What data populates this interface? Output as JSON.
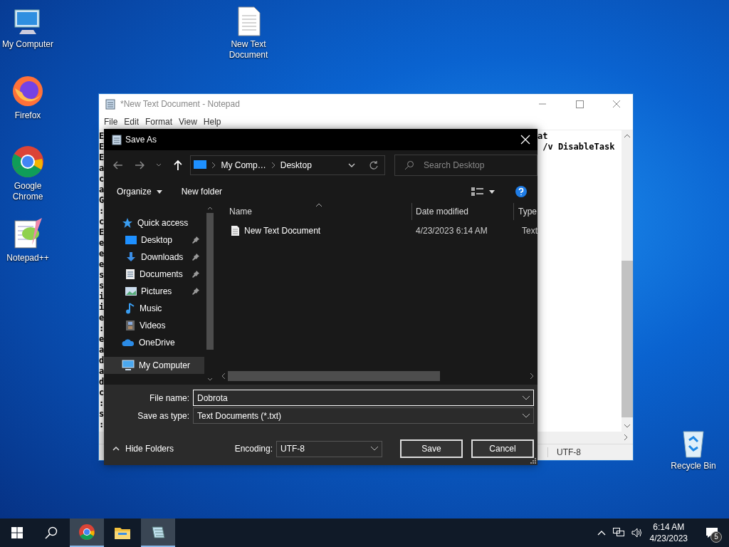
{
  "desktop_icons": [
    {
      "label": "My Computer",
      "kind": "computer"
    },
    {
      "label": "New Text Document",
      "kind": "document"
    },
    {
      "label": "Firefox",
      "kind": "firefox"
    },
    {
      "label": "Google Chrome",
      "kind": "chrome"
    },
    {
      "label": "Notepad++",
      "kind": "notepadpp"
    },
    {
      "label": "Recycle Bin",
      "kind": "recycle"
    }
  ],
  "notepad": {
    "title": "*New Text Document - Notepad",
    "menu": [
      "File",
      "Edit",
      "Format",
      "View",
      "Help"
    ],
    "lines": [
      {
        "start": "E",
        "end": "at"
      },
      {
        "start": "E",
        "end": " /v DisableTask"
      },
      {
        "start": "E"
      },
      {
        "start": "a"
      },
      {
        "start": "c"
      },
      {
        "start": "a"
      },
      {
        "start": "G"
      },
      {
        "start": ":"
      },
      {
        "start": "c"
      },
      {
        "start": "E"
      },
      {
        "start": "e"
      },
      {
        "start": "e"
      },
      {
        "start": "e"
      },
      {
        "start": "s"
      },
      {
        "start": "s"
      },
      {
        "start": "i"
      },
      {
        "start": "i"
      },
      {
        "start": "e"
      },
      {
        "start": ":"
      },
      {
        "start": "e"
      },
      {
        "start": "a"
      },
      {
        "start": "d"
      },
      {
        "start": "a"
      },
      {
        "start": "d"
      },
      {
        "start": "c"
      },
      {
        "start": ":"
      },
      {
        "start": "s"
      },
      {
        "start": ":"
      }
    ],
    "status": "UTF-8"
  },
  "dialog": {
    "title": "Save As",
    "breadcrumb": [
      "My Comp…",
      "Desktop"
    ],
    "search_placeholder": "Search Desktop",
    "organize": "Organize",
    "new_folder": "New folder",
    "nav": [
      {
        "label": "Quick access",
        "kind": "star",
        "selected": false,
        "children": [
          {
            "label": "Desktop",
            "kind": "desktop",
            "pinned": true,
            "selected": false
          },
          {
            "label": "Downloads",
            "kind": "download",
            "pinned": true,
            "selected": false
          },
          {
            "label": "Documents",
            "kind": "documents",
            "pinned": true,
            "selected": false
          },
          {
            "label": "Pictures",
            "kind": "pictures",
            "pinned": true,
            "selected": false
          },
          {
            "label": "Music",
            "kind": "music",
            "pinned": false,
            "selected": false
          },
          {
            "label": "Videos",
            "kind": "videos",
            "pinned": false,
            "selected": false
          }
        ]
      },
      {
        "label": "OneDrive",
        "kind": "cloud",
        "selected": false
      },
      {
        "label": "My Computer",
        "kind": "computer",
        "selected": true
      }
    ],
    "columns": [
      "Name",
      "Date modified",
      "Type"
    ],
    "files": [
      {
        "name": "New Text Document",
        "date": "4/23/2023 6:14 AM",
        "type": "Text"
      }
    ],
    "file_name_label": "File name:",
    "file_name": "Dobrota",
    "type_label": "Save as type:",
    "save_as_type": "Text Documents (*.txt)",
    "hide_folders": "Hide Folders",
    "encoding_label": "Encoding:",
    "encoding": "UTF-8",
    "buttons": [
      "Save",
      "Cancel"
    ]
  },
  "taskbar": {
    "apps": [
      {
        "kind": "chrome",
        "active": true
      },
      {
        "kind": "explorer",
        "active": false
      },
      {
        "kind": "notepad",
        "active": true
      }
    ],
    "time": "6:14 AM",
    "date": "4/23/2023",
    "notifications": "5"
  }
}
